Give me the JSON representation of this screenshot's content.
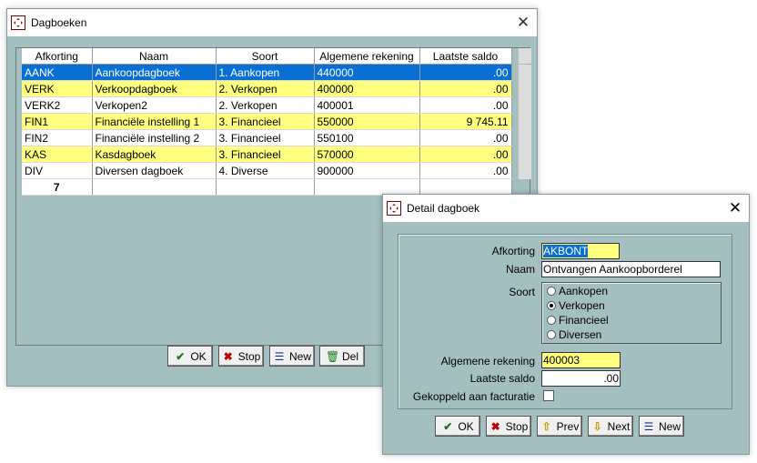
{
  "dagboeken": {
    "title": "Dagboeken",
    "columns": [
      "Afkorting",
      "Naam",
      "Soort",
      "Algemene rekening",
      "Laatste saldo"
    ],
    "rows": [
      {
        "afk": "AANK",
        "naam": "Aankoopdagboek",
        "soort": "1. Aankopen",
        "rek": "440000",
        "saldo": ".00"
      },
      {
        "afk": "VERK",
        "naam": "Verkoopdagboek",
        "soort": "2. Verkopen",
        "rek": "400000",
        "saldo": ".00"
      },
      {
        "afk": "VERK2",
        "naam": "Verkopen2",
        "soort": "2. Verkopen",
        "rek": "400001",
        "saldo": ".00"
      },
      {
        "afk": "FIN1",
        "naam": "Financiële instelling 1",
        "soort": "3. Financieel",
        "rek": "550000",
        "saldo": "9 745.11"
      },
      {
        "afk": "FIN2",
        "naam": "Financiële instelling 2",
        "soort": "3. Financieel",
        "rek": "550100",
        "saldo": ".00"
      },
      {
        "afk": "KAS",
        "naam": "Kasdagboek",
        "soort": "3. Financieel",
        "rek": "570000",
        "saldo": ".00"
      },
      {
        "afk": "DIV",
        "naam": "Diversen dagboek",
        "soort": "4. Diverse",
        "rek": "900000",
        "saldo": ".00"
      }
    ],
    "count": "7",
    "buttons": {
      "ok": "OK",
      "stop": "Stop",
      "new": "New",
      "del": "Del"
    }
  },
  "detail": {
    "title": "Detail dagboek",
    "labels": {
      "afkorting": "Afkorting",
      "naam": "Naam",
      "soort": "Soort",
      "rekening": "Algemene rekening",
      "saldo": "Laatste saldo",
      "gekoppeld": "Gekoppeld aan facturatie"
    },
    "values": {
      "afkorting": "AKBONT",
      "naam": "Ontvangen Aankoopborderel",
      "rekening": "400003",
      "saldo": ".00"
    },
    "soort_options": [
      "Aankopen",
      "Verkopen",
      "Financieel",
      "Diversen"
    ],
    "buttons": {
      "ok": "OK",
      "stop": "Stop",
      "prev": "Prev",
      "next": "Next",
      "new": "New"
    }
  },
  "colors": {
    "selection": "#0a6fd2",
    "highlight_row": "#ffff80",
    "window_bg": "#a3bfbf"
  }
}
